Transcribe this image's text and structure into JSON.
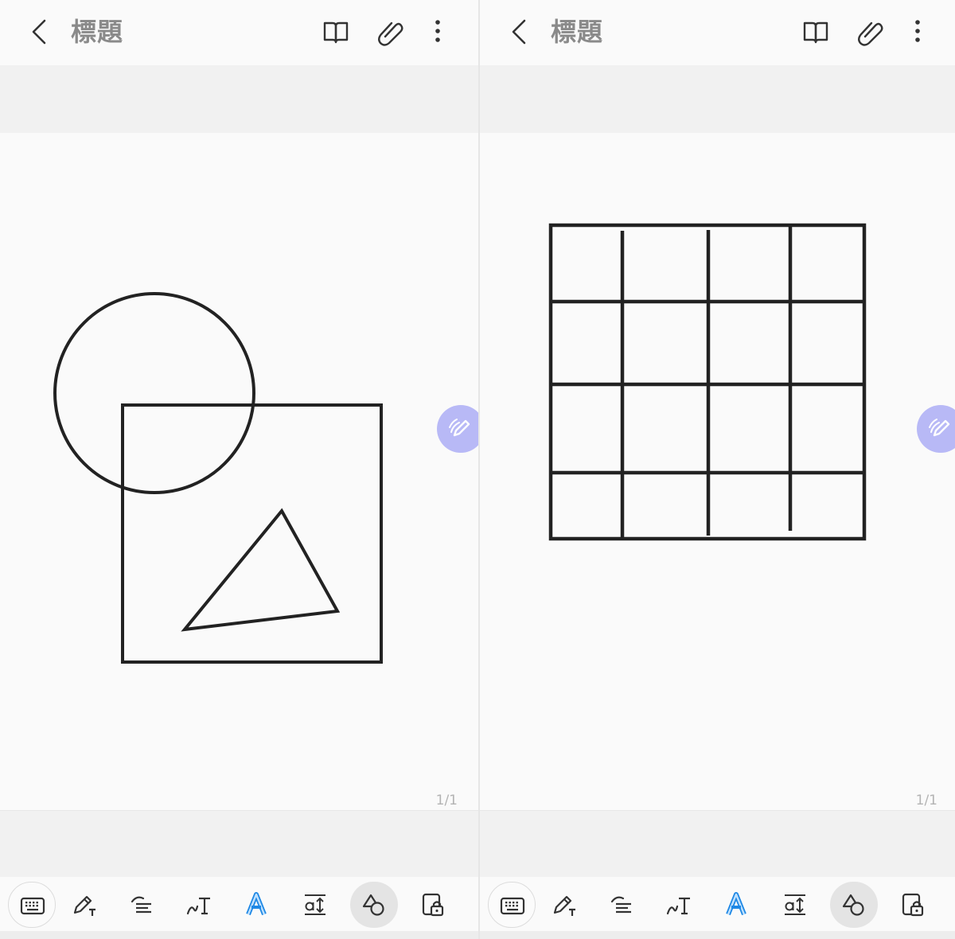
{
  "left_panel": {
    "title": "標題",
    "page_indicator": "1/1"
  },
  "right_panel": {
    "title": "標題",
    "page_indicator": "1/1"
  },
  "icons": {
    "back": "back-arrow-icon",
    "reading_mode": "book-icon",
    "attach": "paperclip-icon",
    "more": "more-vertical-icon",
    "pen_fab": "pen-icon"
  },
  "toolbar_items": [
    "keyboard-icon",
    "pen-settings-icon",
    "text-align-icon",
    "handwriting-to-text-icon",
    "text-style-icon",
    "text-spacing-icon",
    "shape-icon",
    "lock-icon"
  ],
  "colors": {
    "accent_fab": "#b8b9f6",
    "ink": "#222222",
    "title_gray": "#8a8a8a",
    "text_style_blue": "#1e88e5"
  }
}
